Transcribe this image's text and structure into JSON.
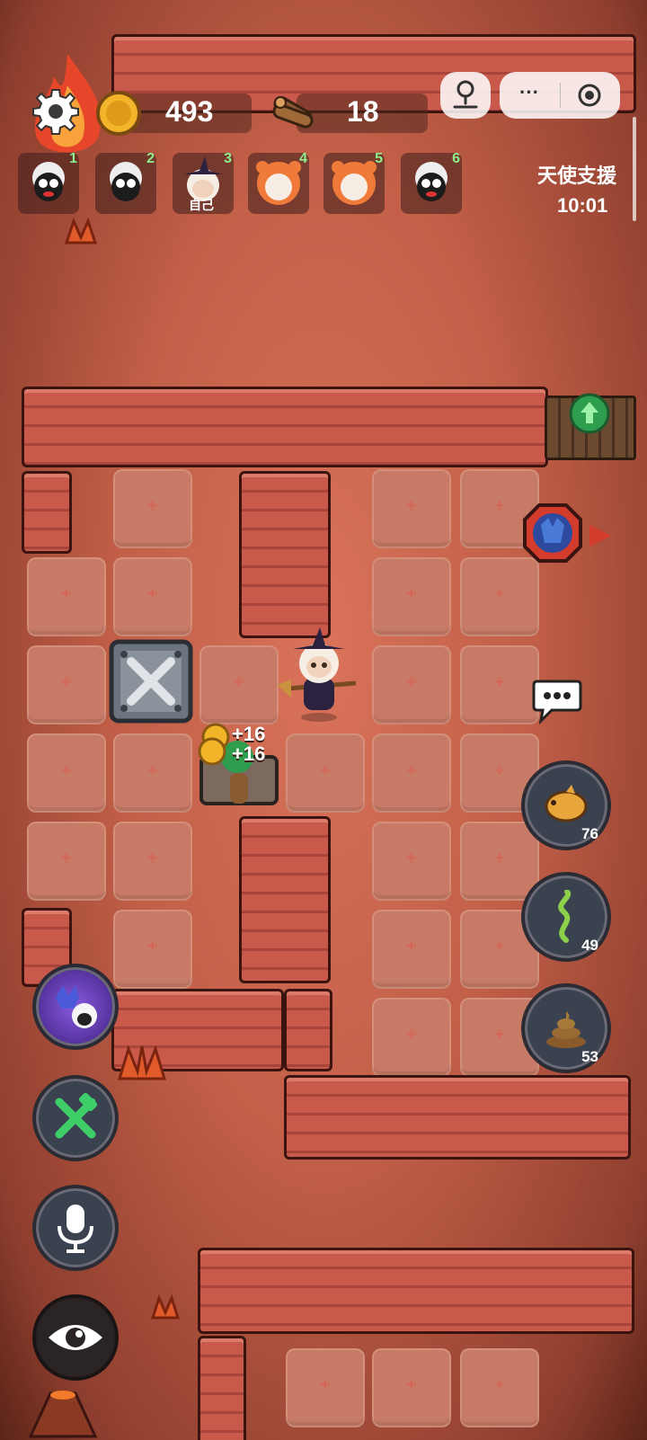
{
  "resources": {
    "coins": "493",
    "wood": "18"
  },
  "team": [
    {
      "num": "1",
      "type": "black-sheep"
    },
    {
      "num": "2",
      "type": "black-sheep"
    },
    {
      "num": "3",
      "type": "witch-sheep",
      "tag": "自己"
    },
    {
      "num": "4",
      "type": "tiger-hood-sheep"
    },
    {
      "num": "5",
      "type": "tiger-hood-sheep"
    },
    {
      "num": "6",
      "type": "black-sheep"
    }
  ],
  "event": {
    "title": "天使支援",
    "timer": "10:01"
  },
  "floating_gain": [
    "+16",
    "+16"
  ],
  "items": {
    "piggy": "76",
    "vine": "49",
    "poop": "53"
  },
  "colors": {
    "accent_green": "#2e9e4e",
    "wall": "#c9594b",
    "floor": "#c77a66"
  }
}
